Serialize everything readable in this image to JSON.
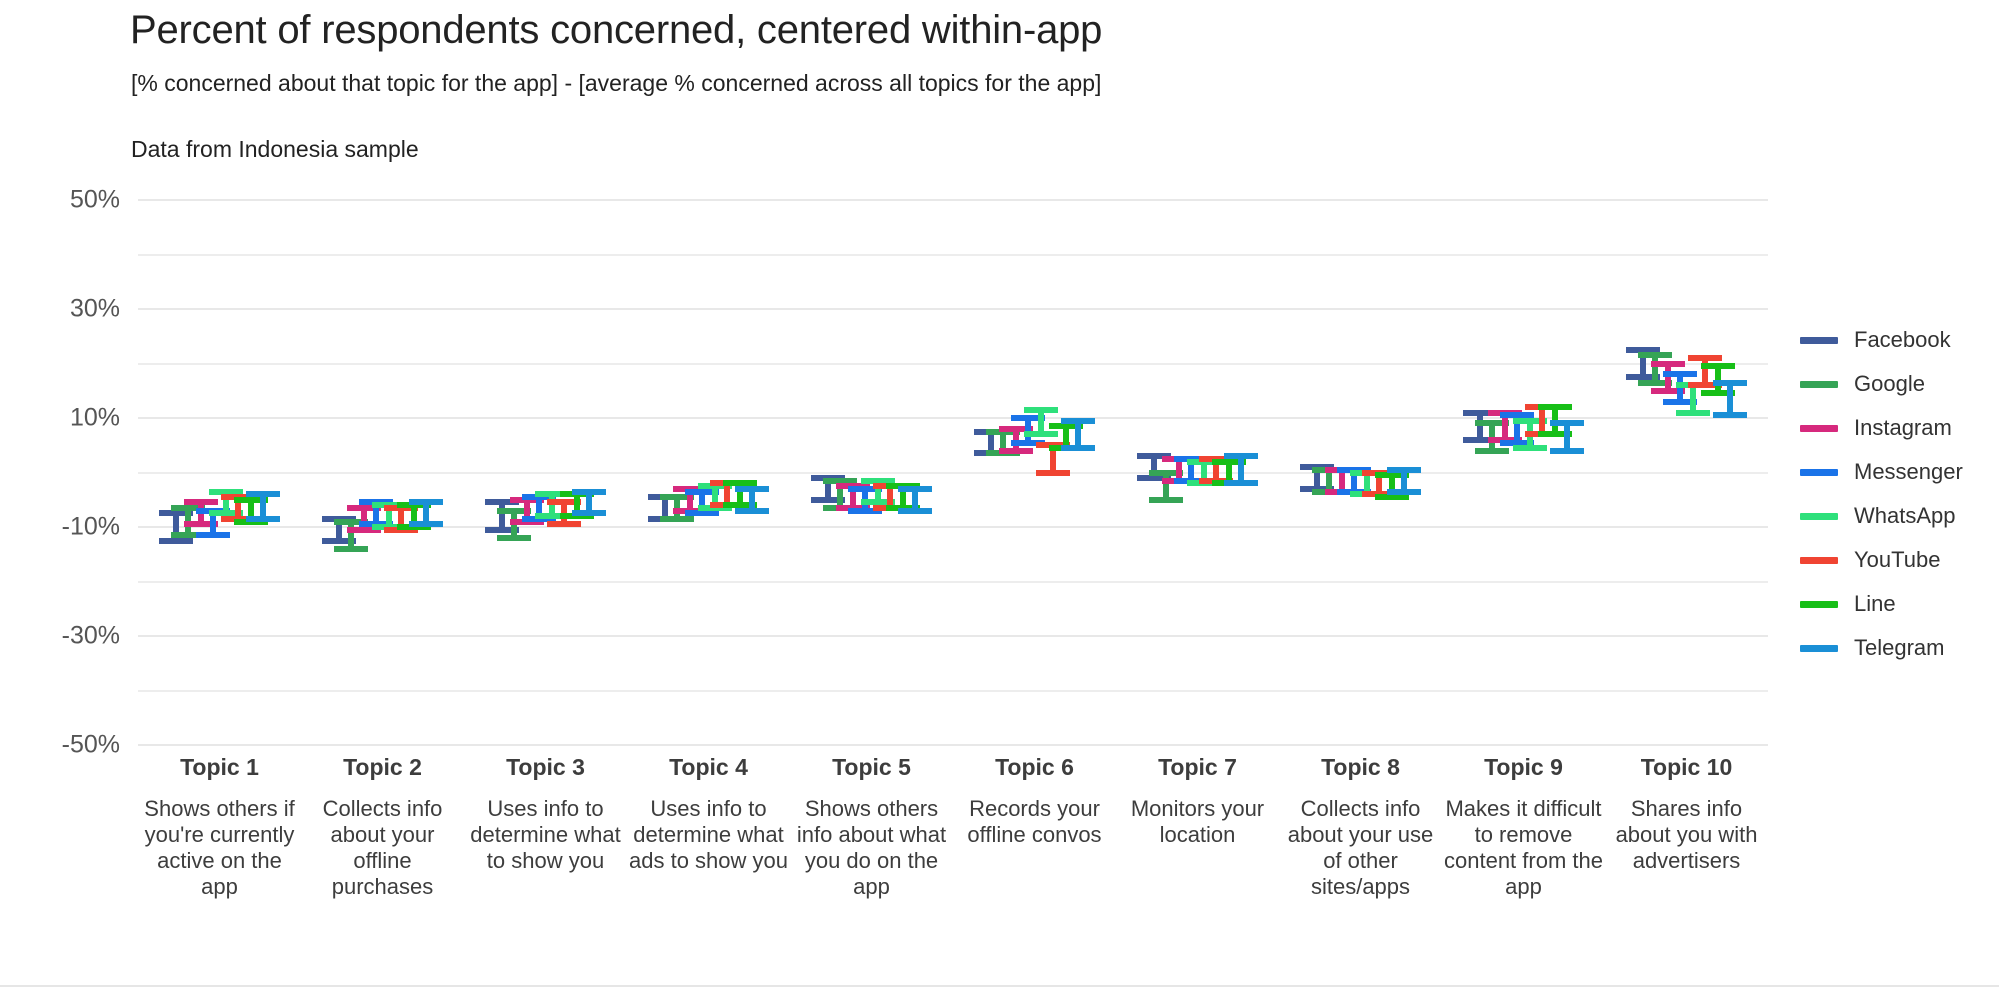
{
  "header": {
    "title": "Percent of respondents concerned, centered within-app",
    "subtitle": "[% concerned about that topic for the app] - [average % concerned across all topics for the app]",
    "note": "Data from Indonesia sample"
  },
  "chart_data": {
    "type": "scatter",
    "title": "Percent of respondents concerned, centered within-app",
    "subtitle": "[% concerned about that topic for the app] - [average % concerned across all topics for the app]",
    "annotation": "Data from Indonesia sample",
    "xlabel": "",
    "ylabel": "",
    "ylim": [
      -50,
      50
    ],
    "grid": true,
    "grid_step": 10,
    "legend_position": "right",
    "y_tick_labels": [
      "50%",
      "30%",
      "10%",
      "-10%",
      "-30%",
      "-50%"
    ],
    "y_tick_values": [
      50,
      30,
      10,
      -10,
      -30,
      -50
    ],
    "y_gridline_values": [
      50,
      40,
      30,
      20,
      10,
      0,
      -10,
      -20,
      -30,
      -40,
      -50
    ],
    "categories": [
      {
        "name": "Topic 1",
        "desc": "Shows others if you're currently active on the app"
      },
      {
        "name": "Topic 2",
        "desc": "Collects info about your offline purchases"
      },
      {
        "name": "Topic 3",
        "desc": "Uses info to determine what to show you"
      },
      {
        "name": "Topic 4",
        "desc": "Uses info to determine what ads to show you"
      },
      {
        "name": "Topic 5",
        "desc": "Shows others info about what you do on the app"
      },
      {
        "name": "Topic 6",
        "desc": "Records your offline convos"
      },
      {
        "name": "Topic 7",
        "desc": "Monitors your location"
      },
      {
        "name": "Topic 8",
        "desc": "Collects info about your use of other sites/apps"
      },
      {
        "name": "Topic 9",
        "desc": "Makes it difficult to remove content from the app"
      },
      {
        "name": "Topic 10",
        "desc": "Shares info about you with advertisers"
      }
    ],
    "series": [
      {
        "name": "Facebook",
        "color": "#3f5b9b",
        "values": [
          -10.0,
          -10.5,
          -8.0,
          -6.5,
          -3.0,
          5.5,
          1.0,
          -1.0,
          8.5,
          20.0
        ],
        "ci_low": [
          -12.5,
          -12.5,
          -10.5,
          -8.5,
          -5.0,
          3.5,
          -1.0,
          -3.0,
          6.0,
          17.5
        ],
        "ci_high": [
          -7.5,
          -8.5,
          -5.5,
          -4.5,
          -1.0,
          7.5,
          3.0,
          1.0,
          11.0,
          22.5
        ]
      },
      {
        "name": "Google",
        "color": "#35a456",
        "values": [
          -9.0,
          -11.5,
          -9.5,
          -6.5,
          -4.0,
          5.5,
          -2.5,
          -1.5,
          6.5,
          19.0
        ],
        "ci_low": [
          -11.5,
          -14.0,
          -12.0,
          -8.5,
          -6.5,
          3.5,
          -5.0,
          -3.5,
          4.0,
          16.5
        ],
        "ci_high": [
          -6.5,
          -9.0,
          -7.0,
          -4.5,
          -1.5,
          7.5,
          0.0,
          0.5,
          9.0,
          21.5
        ]
      },
      {
        "name": "Instagram",
        "color": "#d6297d",
        "values": [
          -7.5,
          -8.5,
          -7.0,
          -5.0,
          -4.5,
          6.0,
          0.5,
          -1.5,
          8.5,
          17.5
        ],
        "ci_low": [
          -9.5,
          -10.5,
          -9.0,
          -7.0,
          -6.5,
          4.0,
          -1.5,
          -3.5,
          6.0,
          15.0
        ],
        "ci_high": [
          -5.5,
          -6.5,
          -5.0,
          -3.0,
          -2.5,
          8.0,
          2.5,
          0.5,
          11.0,
          20.0
        ]
      },
      {
        "name": "Messenger",
        "color": "#1a73e8",
        "values": [
          -9.5,
          -7.5,
          -6.5,
          -5.5,
          -5.0,
          7.5,
          0.5,
          -1.5,
          8.0,
          15.5
        ],
        "ci_low": [
          -11.5,
          -9.5,
          -8.5,
          -7.5,
          -7.0,
          5.5,
          -1.5,
          -3.5,
          5.5,
          13.0
        ],
        "ci_high": [
          -7.0,
          -5.5,
          -4.5,
          -3.5,
          -3.0,
          10.0,
          2.5,
          0.5,
          10.5,
          18.0
        ]
      },
      {
        "name": "WhatsApp",
        "color": "#2ee07b",
        "values": [
          -5.5,
          -8.0,
          -6.0,
          -4.5,
          -3.5,
          9.0,
          0.0,
          -2.0,
          7.0,
          13.5
        ],
        "ci_low": [
          -7.5,
          -10.0,
          -8.0,
          -6.5,
          -5.5,
          7.0,
          -2.0,
          -4.0,
          4.5,
          11.0
        ],
        "ci_high": [
          -3.5,
          -6.0,
          -4.0,
          -2.5,
          -1.5,
          11.5,
          2.0,
          0.0,
          9.5,
          16.0
        ]
      },
      {
        "name": "YouTube",
        "color": "#f04432",
        "values": [
          -6.5,
          -8.5,
          -7.5,
          -4.0,
          -4.5,
          2.5,
          0.5,
          -2.0,
          9.5,
          18.5
        ],
        "ci_low": [
          -8.5,
          -10.5,
          -9.5,
          -6.0,
          -6.5,
          0.0,
          -1.5,
          -4.0,
          7.0,
          16.0
        ],
        "ci_high": [
          -4.5,
          -6.5,
          -5.5,
          -2.0,
          -2.5,
          5.0,
          2.5,
          0.0,
          12.0,
          21.0
        ]
      },
      {
        "name": "Line",
        "color": "#17bf17",
        "values": [
          -7.0,
          -8.0,
          -6.0,
          -4.0,
          -4.5,
          6.5,
          0.0,
          -2.5,
          9.5,
          17.0
        ],
        "ci_low": [
          -9.0,
          -10.0,
          -8.0,
          -6.0,
          -6.5,
          4.5,
          -2.0,
          -4.5,
          7.0,
          14.5
        ],
        "ci_high": [
          -5.0,
          -6.0,
          -4.0,
          -2.0,
          -2.5,
          8.5,
          2.0,
          -0.5,
          12.0,
          19.5
        ]
      },
      {
        "name": "Telegram",
        "color": "#1a8fd6",
        "values": [
          -6.5,
          -7.5,
          -5.5,
          -5.0,
          -5.0,
          7.0,
          0.5,
          -1.5,
          6.5,
          13.5
        ],
        "ci_low": [
          -8.5,
          -9.5,
          -7.5,
          -7.0,
          -7.0,
          4.5,
          -2.0,
          -3.5,
          4.0,
          10.5
        ],
        "ci_high": [
          -4.0,
          -5.5,
          -3.5,
          -3.0,
          -3.0,
          9.5,
          3.0,
          0.5,
          9.0,
          16.5
        ]
      }
    ]
  },
  "legend": {
    "items": [
      {
        "label": "Facebook",
        "color": "#3f5b9b"
      },
      {
        "label": "Google",
        "color": "#35a456"
      },
      {
        "label": "Instagram",
        "color": "#d6297d"
      },
      {
        "label": "Messenger",
        "color": "#1a73e8"
      },
      {
        "label": "WhatsApp",
        "color": "#2ee07b"
      },
      {
        "label": "YouTube",
        "color": "#f04432"
      },
      {
        "label": "Line",
        "color": "#17bf17"
      },
      {
        "label": "Telegram",
        "color": "#1a8fd6"
      }
    ]
  }
}
